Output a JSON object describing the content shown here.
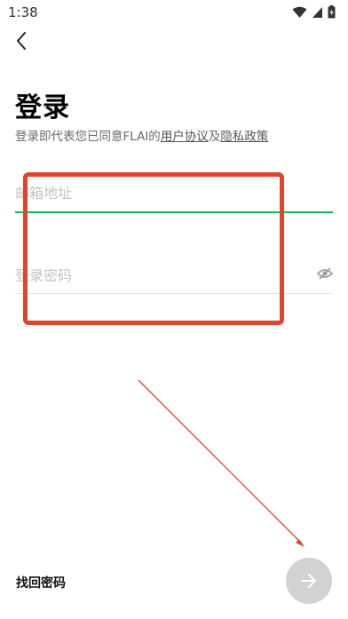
{
  "status_bar": {
    "time": "1:38"
  },
  "page": {
    "title": "登录",
    "agreement_prefix": "登录即代表您已同意FLAI的",
    "user_agreement": "用户协议",
    "and": "及",
    "privacy_policy": "隐私政策"
  },
  "form": {
    "email_placeholder": "邮箱地址",
    "password_placeholder": "登录密码"
  },
  "footer": {
    "forgot_password": "找回密码"
  },
  "colors": {
    "focus_line": "#19b955",
    "annotation": "#e0442c",
    "next_button": "#d2d2d2"
  }
}
